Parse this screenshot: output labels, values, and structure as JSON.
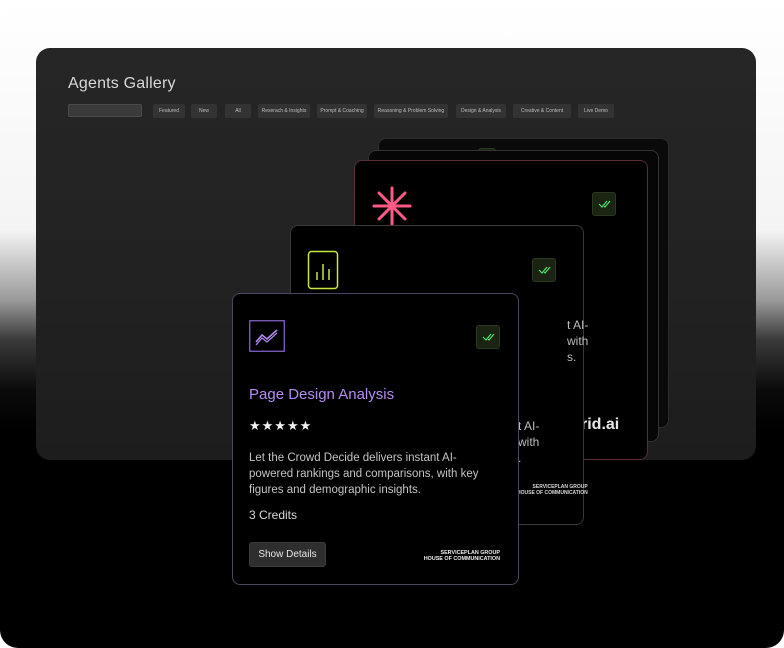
{
  "gallery": {
    "title": "Agents Gallery",
    "search_placeholder": "",
    "filters": [
      "Featured",
      "New",
      "All",
      "Reserach & Insights",
      "Prompt & Coaching",
      "Reasoning & Problem Solving",
      "Design & Analysis",
      "Creative & Content",
      "Live Demo"
    ]
  },
  "cards_back": {
    "card2_partial_lines": [
      "t AI-",
      "with",
      "s."
    ],
    "card3_partial_lines": [
      "t AI-",
      "with",
      "."
    ],
    "card3_brand": "rid.ai",
    "card2_logo": [
      "SERVICEPLAN GROUP",
      "HOUSE OF COMMUNICATION"
    ]
  },
  "active_card": {
    "title": "Page Design Analysis",
    "rating": "★★★★★",
    "description": "Let the Crowd Decide delivers instant AI-powered rankings and comparisons, with key figures and demographic insights.",
    "credits": "3 Credits",
    "button_label": "Show Details",
    "logo_line1": "SERVICEPLAN GROUP",
    "logo_line2": "HOUSE OF COMMUNICATION"
  },
  "colors": {
    "accent_purple": "#b48cf2",
    "accent_pink": "#ff5a86",
    "accent_lime": "#c8e642",
    "check_green": "#4ee06e"
  }
}
